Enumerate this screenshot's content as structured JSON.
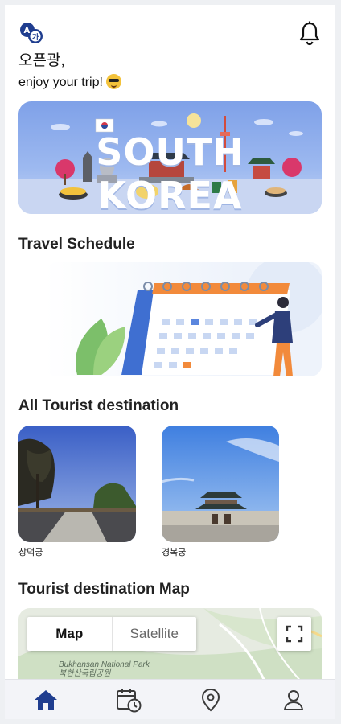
{
  "header": {
    "greeting": "오픈광,",
    "subtitle": "enjoy your trip!",
    "logo_icon": "translate-logo-icon",
    "notification_icon": "bell-icon"
  },
  "banner": {
    "title": "SOUTH KOREA"
  },
  "sections": {
    "schedule_title": "Travel Schedule",
    "destinations_title": "All Tourist destination",
    "map_title": "Tourist destination Map"
  },
  "destinations": [
    {
      "name": "창덕궁"
    },
    {
      "name": "경복궁"
    }
  ],
  "map": {
    "map_label": "Map",
    "satellite_label": "Satellite",
    "place_en": "Bukhansan National Park",
    "place_ko": "북한산국립공원",
    "fullscreen_icon": "fullscreen-icon"
  },
  "tabbar": {
    "items": [
      "home-icon",
      "calendar-clock-icon",
      "location-pin-icon",
      "profile-icon"
    ],
    "active_color": "#1f3d8f",
    "inactive_color": "#3a3a3a"
  }
}
